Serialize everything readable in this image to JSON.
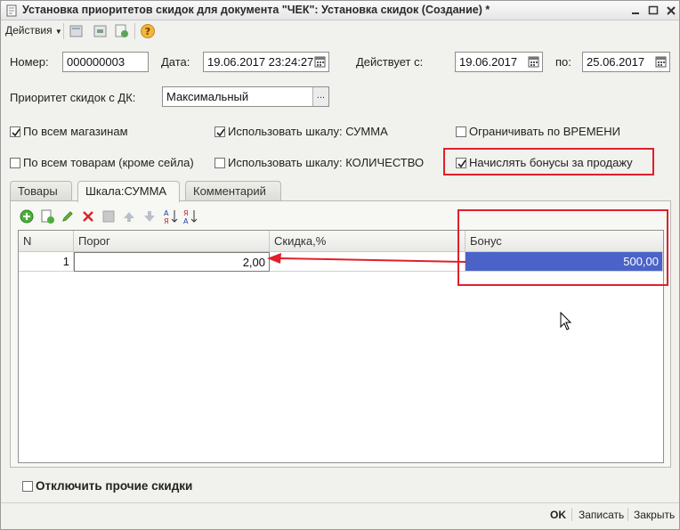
{
  "window": {
    "title": "Установка приоритетов скидок для документа \"ЧЕК\": Установка скидок (Создание) *"
  },
  "toolbar": {
    "actions_label": "Действия"
  },
  "header": {
    "number_label": "Номер:",
    "number_value": "000000003",
    "date_label": "Дата:",
    "date_value": "19.06.2017 23:24:27",
    "valid_from_label": "Действует с:",
    "valid_from_value": "19.06.2017",
    "valid_to_label": "по:",
    "valid_to_value": "25.06.2017",
    "priority_label": "Приоритет скидок с ДК:",
    "priority_value": "Максимальный",
    "select_button": "..."
  },
  "checkboxes": [
    {
      "label": "По всем магазинам",
      "checked": true
    },
    {
      "label": "Использовать шкалу: СУММА",
      "checked": true
    },
    {
      "label": "Ограничивать по ВРЕМЕНИ",
      "checked": false
    },
    {
      "label": "По всем товарам (кроме сейла)",
      "checked": false
    },
    {
      "label": "Использовать шкалу: КОЛИЧЕСТВО",
      "checked": false
    },
    {
      "label": "Начислять бонусы за продажу",
      "checked": true
    }
  ],
  "tabs": [
    {
      "label": "Товары",
      "active": false
    },
    {
      "label": "Шкала:СУММА",
      "active": true
    },
    {
      "label": "Комментарий",
      "active": false
    }
  ],
  "grid": {
    "columns": [
      "N",
      "Порог",
      "Скидка,%",
      "Бонус"
    ],
    "rows": [
      {
        "n": "1",
        "threshold": "2,00",
        "discount": "",
        "bonus": "500,00"
      }
    ]
  },
  "footer": {
    "disable_other_label": "Отключить прочие скидки",
    "ok": "OK",
    "save": "Записать",
    "close": "Закрыть"
  },
  "colors": {
    "highlight": "#e0202a",
    "selected_cell": "#4b63c9"
  }
}
